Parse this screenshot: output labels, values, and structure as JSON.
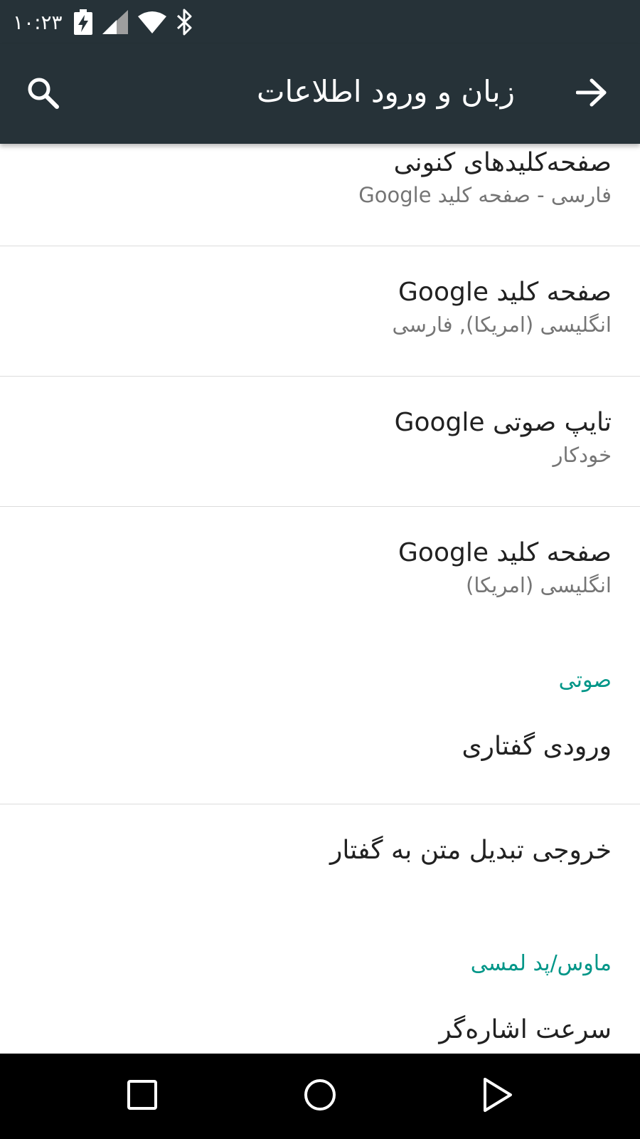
{
  "status_bar": {
    "time": "۱۰:۲۳",
    "icons": [
      "battery-charging-icon",
      "cell-signal-icon",
      "wifi-icon",
      "bluetooth-icon"
    ]
  },
  "app_bar": {
    "title": "زبان و ورود اطلاعات",
    "search_icon": "search-icon",
    "back_icon": "arrow-forward-icon"
  },
  "items": [
    {
      "title": "صفحه‌کلیدهای کنونی",
      "subtitle": "فارسی - صفحه کلید Google"
    },
    {
      "title": "صفحه کلید Google",
      "subtitle": "انگلیسی (امریکا), فارسی"
    },
    {
      "title": "تایپ صوتی Google",
      "subtitle": "خودکار"
    },
    {
      "title": "صفحه کلید Google",
      "subtitle": "انگلیسی (امریکا)"
    }
  ],
  "sections": {
    "speech": {
      "header": "صوتی",
      "items": [
        {
          "title": "ورودی گفتاری"
        },
        {
          "title": "خروجی تبدیل متن به گفتار"
        }
      ]
    },
    "mouse": {
      "header": "ماوس/پد لمسی",
      "items": [
        {
          "title": "سرعت اشاره‌گر"
        }
      ]
    }
  },
  "colors": {
    "app_bar": "#263238",
    "accent": "#009688",
    "primary_text": "#212121",
    "secondary_text": "#757575",
    "nav_bar": "#000000"
  },
  "nav_bar": {
    "icons": [
      "recents-icon",
      "home-icon",
      "back-icon"
    ]
  }
}
